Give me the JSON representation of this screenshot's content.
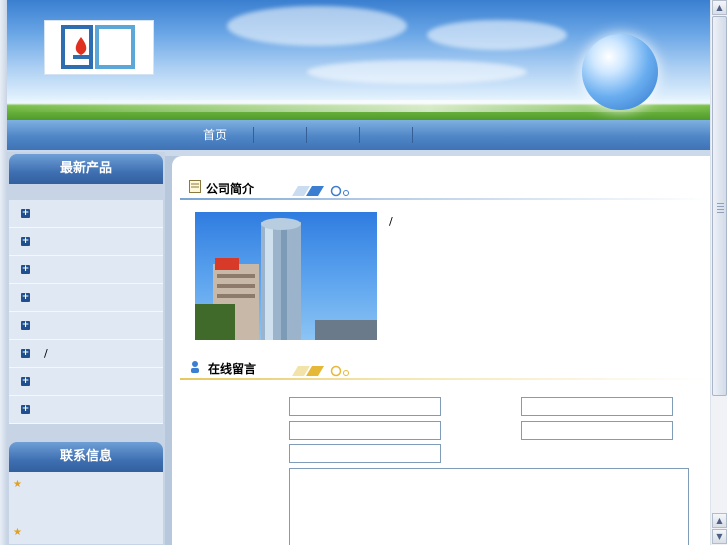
{
  "header": {
    "company_name": "",
    "logo_name": "company-logo"
  },
  "nav": {
    "items": [
      "首页",
      "",
      "",
      "",
      ""
    ]
  },
  "sidebar": {
    "products_title": "最新产品",
    "products": [
      "",
      "",
      "",
      "",
      "",
      "/",
      "",
      ""
    ],
    "contact_title": "联系信息",
    "contact_rows": [
      {
        "star": true,
        "text": ""
      },
      {
        "star": false,
        "text": ""
      },
      {
        "star": true,
        "text": ""
      }
    ]
  },
  "main": {
    "about_title": "公司简介",
    "about_paragraphs": [
      "",
      "/",
      "",
      "",
      ""
    ],
    "message_title": "在线留言",
    "form_labels": [
      "",
      "",
      "",
      "",
      "",
      ""
    ]
  },
  "colors": {
    "nav_bg": "#4f86c6",
    "sidebar_title_bg": "#3f70b2",
    "sidebar_list_bg": "#dfe8f3",
    "input_border": "#7f9db9"
  }
}
